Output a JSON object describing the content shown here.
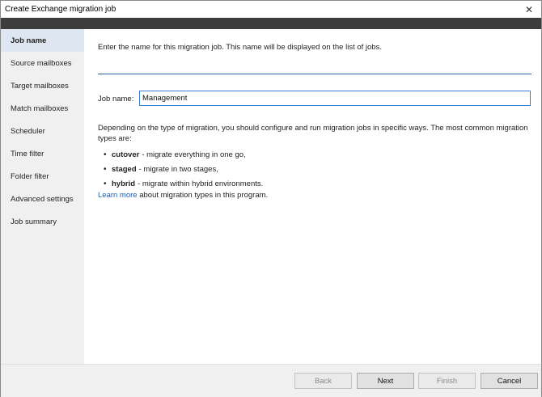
{
  "window": {
    "title": "Create Exchange migration job",
    "close_glyph": "✕"
  },
  "sidebar": {
    "items": [
      {
        "label": "Job name",
        "active": true
      },
      {
        "label": "Source mailboxes"
      },
      {
        "label": "Target mailboxes"
      },
      {
        "label": "Match mailboxes"
      },
      {
        "label": "Scheduler"
      },
      {
        "label": "Time filter"
      },
      {
        "label": "Folder filter"
      },
      {
        "label": "Advanced settings"
      },
      {
        "label": "Job summary"
      }
    ]
  },
  "main": {
    "intro": "Enter the name for this migration job. This name will be displayed on the list of jobs.",
    "job_name_label": "Job name:",
    "job_name_value": "Management",
    "description": "Depending on the type of migration, you should configure and run migration jobs in specific ways. The most common migration types are:",
    "types": [
      {
        "name": "cutover",
        "text": "- migrate everything in one go,"
      },
      {
        "name": "staged",
        "text": "- migrate in two stages,"
      },
      {
        "name": "hybrid",
        "text": "- migrate within hybrid environments."
      }
    ],
    "learn_more_link": "Learn more",
    "learn_more_rest": " about migration types in this program."
  },
  "footer": {
    "back": "Back",
    "next": "Next",
    "finish": "Finish",
    "cancel": "Cancel"
  },
  "colors": {
    "accent": "#3b7bd5",
    "link": "#1a5fb4",
    "sidebar_bg": "#f0f0f0",
    "sidebar_active": "#dde6f1",
    "dark_bar": "#3d3d3d"
  }
}
